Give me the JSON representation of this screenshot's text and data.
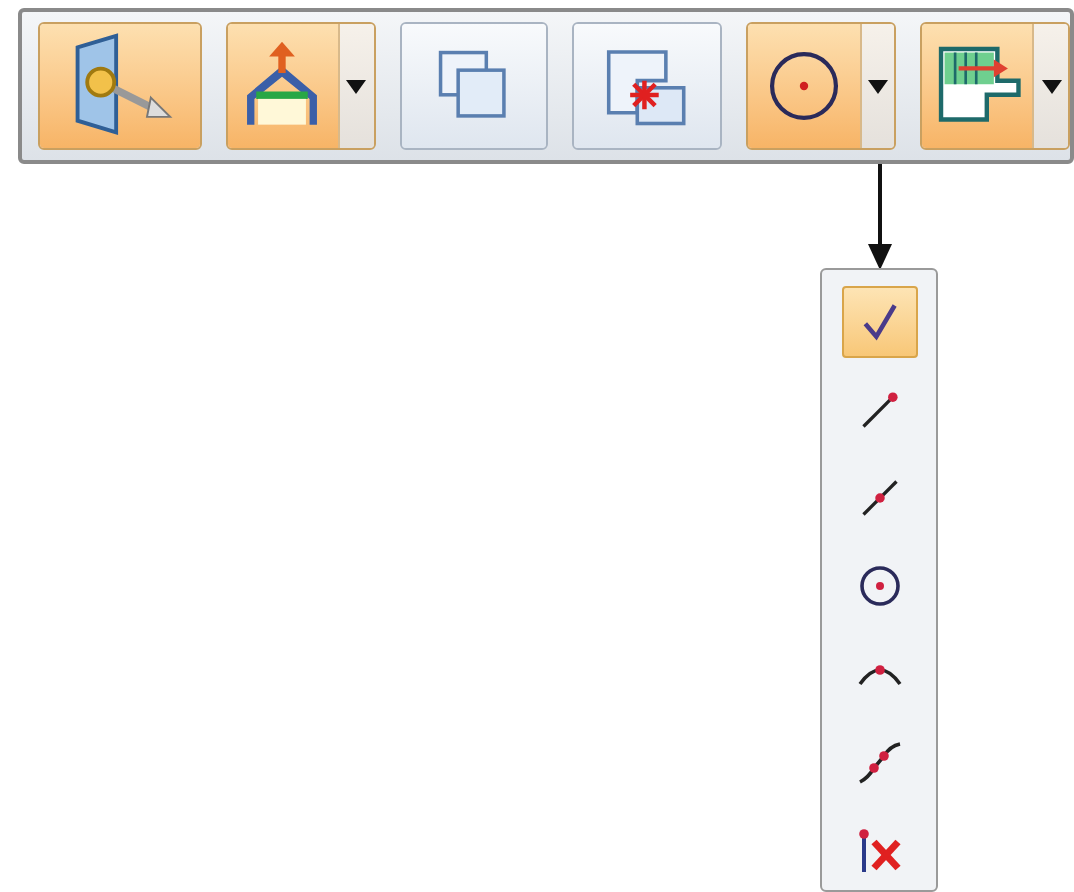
{
  "toolbar": {
    "buttons": [
      {
        "kind": "panel-pin",
        "selected": true,
        "has_dropdown": false
      },
      {
        "kind": "triangle-arrow",
        "selected": true,
        "has_dropdown": true
      },
      {
        "kind": "overlap-squares",
        "selected": false,
        "has_dropdown": false
      },
      {
        "kind": "squares-star",
        "selected": false,
        "has_dropdown": false
      },
      {
        "kind": "circle-dot",
        "selected": true,
        "has_dropdown": true
      },
      {
        "kind": "step-shape",
        "selected": true,
        "has_dropdown": true
      }
    ]
  },
  "dropdown_menu": {
    "items": [
      {
        "kind": "check",
        "selected": true
      },
      {
        "kind": "line-end",
        "selected": false
      },
      {
        "kind": "line-mid",
        "selected": false
      },
      {
        "kind": "circle-center",
        "selected": false
      },
      {
        "kind": "arc-top",
        "selected": false
      },
      {
        "kind": "curve-points",
        "selected": false
      },
      {
        "kind": "clear",
        "selected": false
      }
    ]
  }
}
